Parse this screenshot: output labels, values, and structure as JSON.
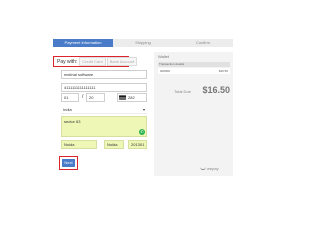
{
  "steps": [
    {
      "label": "Payment Information",
      "active": true
    },
    {
      "label": "Shipping",
      "active": false
    },
    {
      "label": "Confirm",
      "active": false
    }
  ],
  "payment": {
    "tabs": [
      "Pay with:",
      "Credit Card",
      "Bank Account"
    ],
    "name_on_card": "mekhal software",
    "card_number": "4111111111111111",
    "exp_month": "01",
    "exp_year": "20",
    "cvv": "282",
    "country": "India",
    "address": "sector 63",
    "city": "Noida",
    "state": "Noida",
    "zip": "201301",
    "next_label": "Next"
  },
  "summary": {
    "title": "Wallet",
    "header": "Transaction details",
    "row_label": "000000",
    "row_amount": "$16.50",
    "total_label": "Total Due",
    "total_value": "$16.50"
  },
  "footer": {
    "brand": "wepay"
  },
  "colors": {
    "accent": "#4a7bc8",
    "highlight_border": "#d9262c",
    "autofill": "#eef7b6"
  }
}
